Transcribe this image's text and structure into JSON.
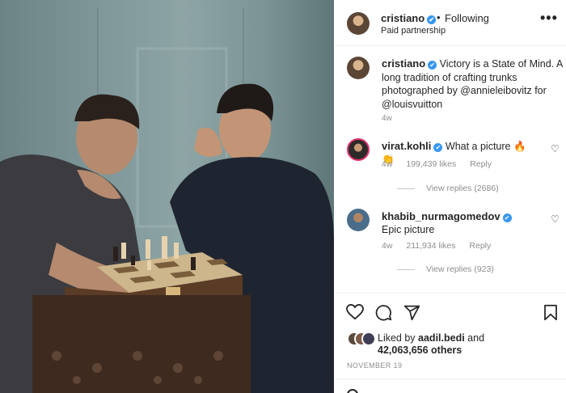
{
  "post": {
    "username": "cristiano",
    "verified_mark": "✔",
    "separator": "•",
    "follow_status": "Following",
    "partnership": "Paid partnership",
    "more_icon": "more-horizontal-icon"
  },
  "caption": {
    "username": "cristiano",
    "text": "Victory is a State of Mind. A long tradition of crafting trunks photographed by @annieleibovitz for @louisvuitton",
    "age": "4w"
  },
  "comments": [
    {
      "username": "virat.kohli",
      "text": "What a picture 🔥👏",
      "age": "4w",
      "likes": "199,439 likes",
      "reply_label": "Reply",
      "view_replies": "View replies (2686)"
    },
    {
      "username": "khabib_nurmagomedov",
      "text": "Epic picture",
      "age": "4w",
      "likes": "211,934 likes",
      "reply_label": "Reply",
      "view_replies": "View replies (923)"
    }
  ],
  "likes": {
    "prefix": "Liked by ",
    "liked_by_user": "aadil.bedi",
    "connector": " and",
    "others": "42,063,656 others"
  },
  "date": "NOVEMBER 19",
  "colors": {
    "verified": "#3897f0",
    "secondary_text": "#8e8e8e",
    "primary_text": "#262626"
  },
  "icons": [
    "heart-icon",
    "comment-icon",
    "share-icon",
    "bookmark-icon"
  ]
}
